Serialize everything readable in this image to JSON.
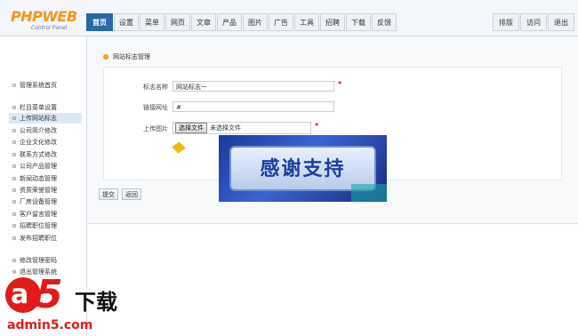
{
  "logo": {
    "main": "PHPWEB",
    "sub": "Control Panel"
  },
  "nav": {
    "items": [
      "首页",
      "设置",
      "菜单",
      "网页",
      "文章",
      "产品",
      "图片",
      "广告",
      "工具",
      "招聘",
      "下载",
      "反馈"
    ],
    "right_items": [
      "排版",
      "访问",
      "退出"
    ]
  },
  "sidebar": {
    "items": [
      "管理系统首页",
      "栏目菜单设置",
      "上传网站标志",
      "公司简介修改",
      "企业文化修改",
      "联系方式修改",
      "公司产品管理",
      "新闻动态管理",
      "资质荣誉管理",
      "厂房设备管理",
      "客户留言管理",
      "招聘职位管理",
      "发布招聘职位",
      "修改管理密码",
      "退出管理系统"
    ],
    "active_index": 2
  },
  "main": {
    "section_title": "网站标志管理",
    "form": {
      "name_label": "标志名称",
      "name_value": "网站标志一",
      "link_label": "链接网址",
      "link_value": "#",
      "image_label": "上传图片",
      "file_button": "选择文件",
      "file_status": "未选择文件",
      "required_mark": "*"
    },
    "submit_label": "提交",
    "back_label": "返回"
  },
  "overlay": {
    "text": "感谢支持"
  },
  "watermark": {
    "a": "a",
    "five": "5",
    "xz": "下载",
    "url": "admin5.com"
  },
  "colors": {
    "nav_active": "#2a68a8",
    "accent": "#f7941d",
    "required": "#d40000"
  }
}
